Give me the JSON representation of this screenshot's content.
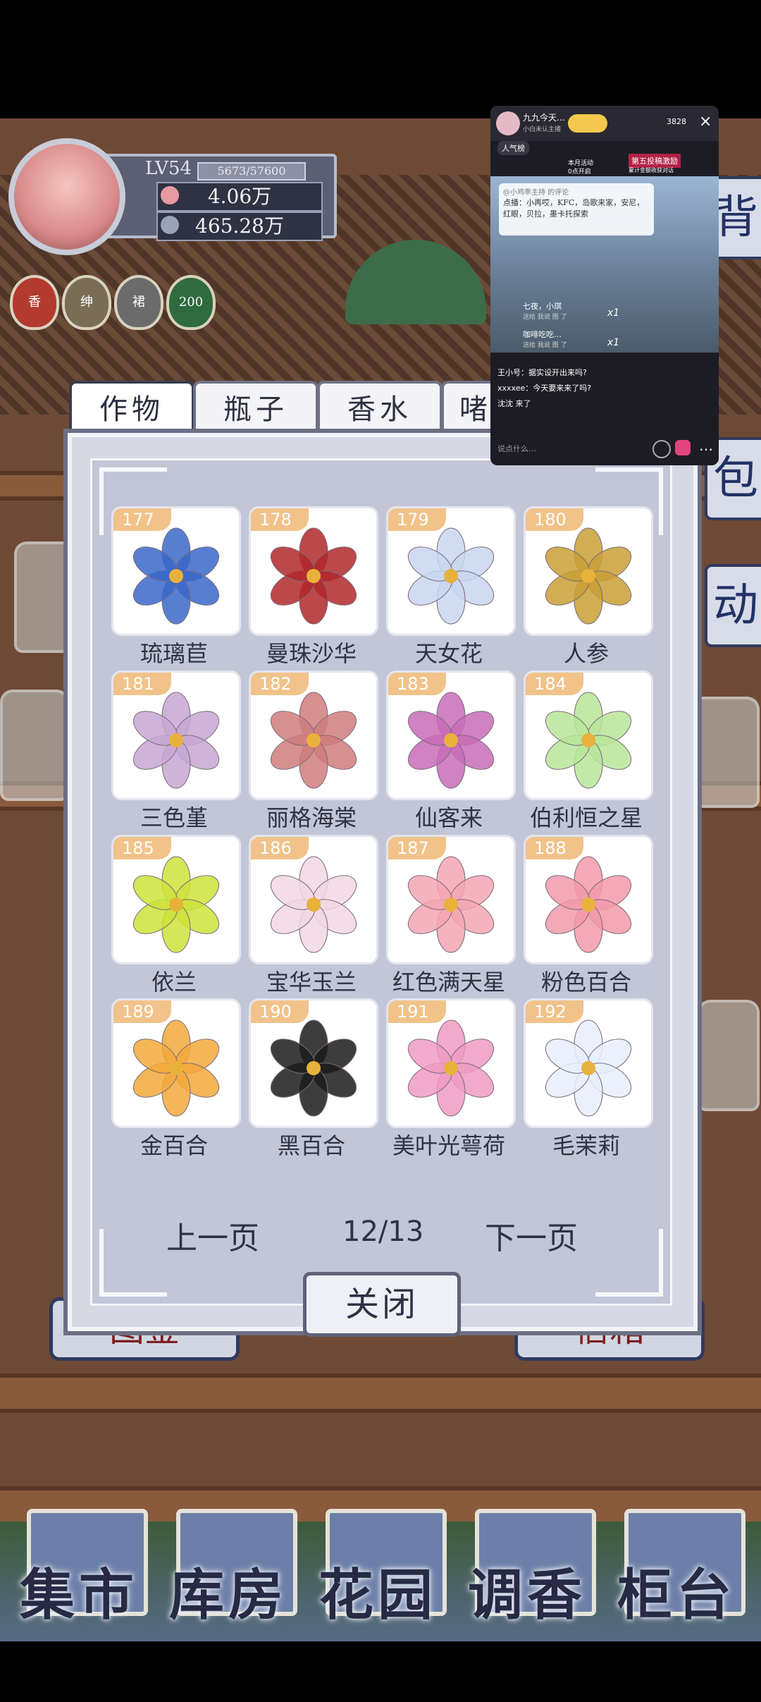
{
  "player": {
    "level": "LV54",
    "exp": "5673/57600",
    "coins": "4.06万",
    "leaves": "465.28万"
  },
  "status_badges": [
    "香",
    "绅",
    "裙",
    "200"
  ],
  "tabs": [
    {
      "label": "作物",
      "active": true
    },
    {
      "label": "瓶子",
      "active": false
    },
    {
      "label": "香水",
      "active": false
    },
    {
      "label": "啫",
      "active": false
    }
  ],
  "items": [
    {
      "num": "177",
      "name": "琉璃苣",
      "color": "#3a67c8"
    },
    {
      "num": "178",
      "name": "曼珠沙华",
      "color": "#b0282a"
    },
    {
      "num": "179",
      "name": "天女花",
      "color": "#c9d6f0"
    },
    {
      "num": "180",
      "name": "人参",
      "color": "#c9a035"
    },
    {
      "num": "181",
      "name": "三色堇",
      "color": "#c7a7d2"
    },
    {
      "num": "182",
      "name": "丽格海棠",
      "color": "#cf7d7d"
    },
    {
      "num": "183",
      "name": "仙客来",
      "color": "#c86cb8"
    },
    {
      "num": "184",
      "name": "伯利恒之星",
      "color": "#b8e59a"
    },
    {
      "num": "185",
      "name": "依兰",
      "color": "#cde33a"
    },
    {
      "num": "186",
      "name": "宝华玉兰",
      "color": "#f1d7e2"
    },
    {
      "num": "187",
      "name": "红色满天星",
      "color": "#f3a6b3"
    },
    {
      "num": "188",
      "name": "粉色百合",
      "color": "#f19aa9"
    },
    {
      "num": "189",
      "name": "金百合",
      "color": "#f2a93b"
    },
    {
      "num": "190",
      "name": "黑百合",
      "color": "#1b1b1b"
    },
    {
      "num": "191",
      "name": "美叶光萼荷",
      "color": "#ef9bc3"
    },
    {
      "num": "192",
      "name": "毛茉莉",
      "color": "#e6eefc"
    }
  ],
  "pagination": {
    "prev": "上一页",
    "page": "12/13",
    "next": "下一页"
  },
  "close_label": "关闭",
  "side_tabs": [
    "背",
    "包",
    "动"
  ],
  "bottom_nav": [
    "集市",
    "库房",
    "花园",
    "调香",
    "柜台"
  ],
  "shelf_signs": [
    "图鉴",
    "信箱"
  ],
  "live": {
    "title": "九九今天…",
    "subtitle": "小白未认主播",
    "viewers": "3828",
    "ranking": "人气榜",
    "activity_line1": "本月活动",
    "activity_line2": "0点开启",
    "promo": "第五投稿激励",
    "promo_sub": "累计金额收获对话",
    "note_head": "@小鸡乖主持 的评论",
    "note_body": "点播：小再哎，KFC，岛歌来家，安尼，红眼，贝拉，墨卡托探索",
    "users": [
      {
        "name": "七夜，小琪",
        "msg": "送给 我说 图 了"
      },
      {
        "name": "咖啡吃吃…",
        "msg": "送给 我说 图 了"
      }
    ],
    "gift_count": "x1",
    "chats": [
      {
        "user": "王小号",
        "text": "据实设开出来吗?"
      },
      {
        "user": "xxxxee",
        "text": "今天要来来了吗?"
      },
      {
        "user": "沈沈",
        "text": "来了"
      }
    ],
    "input_placeholder": "说点什么…"
  }
}
